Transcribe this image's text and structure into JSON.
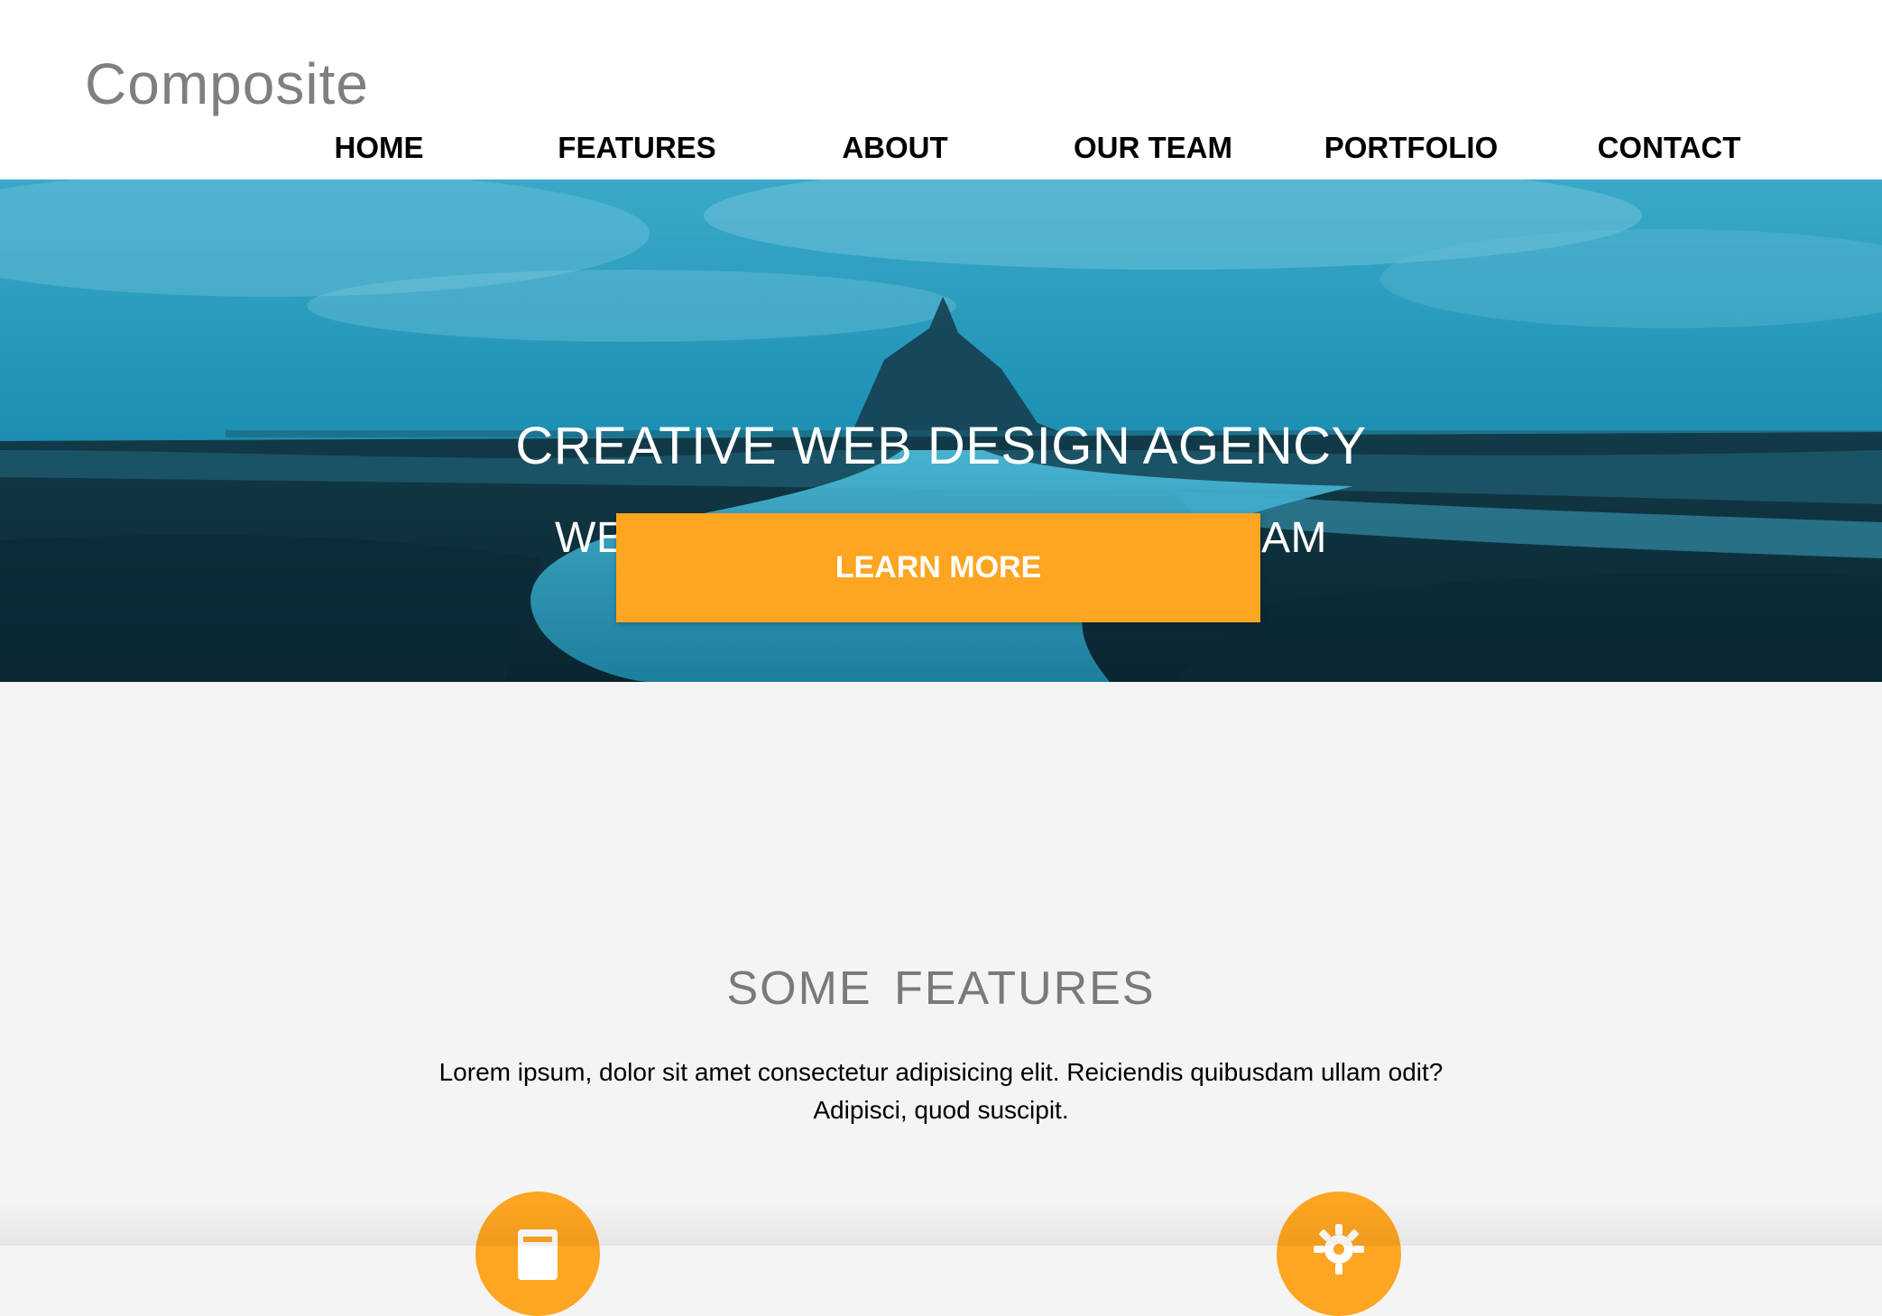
{
  "brand": {
    "logo_text": "Composite"
  },
  "nav": {
    "items": [
      {
        "label": "HOME"
      },
      {
        "label": "FEATURES"
      },
      {
        "label": "ABOUT"
      },
      {
        "label": "OUR TEAM"
      },
      {
        "label": "PORTFOLIO"
      },
      {
        "label": "CONTACT"
      }
    ]
  },
  "hero": {
    "title": "CREATIVE WEB DESIGN AGENCY",
    "subtitle": "WEB DESIGN & CODE YOUR DREAM",
    "cta_label": "LEARN MORE"
  },
  "features": {
    "heading": "SOME FEATURES",
    "text_line1": "Lorem ipsum, dolor sit amet consectetur adipisicing elit. Reiciendis quibusdam ullam odit?",
    "text_line2": "Adipisci, quod suscipit.",
    "icons": [
      {
        "name": "device-icon"
      },
      {
        "name": "gear-icon"
      }
    ]
  },
  "colors": {
    "accent": "#fea521",
    "hero_tint": "#1a9ec2",
    "header_bg": "#ffffff",
    "section_bg": "#f4f4f4"
  }
}
